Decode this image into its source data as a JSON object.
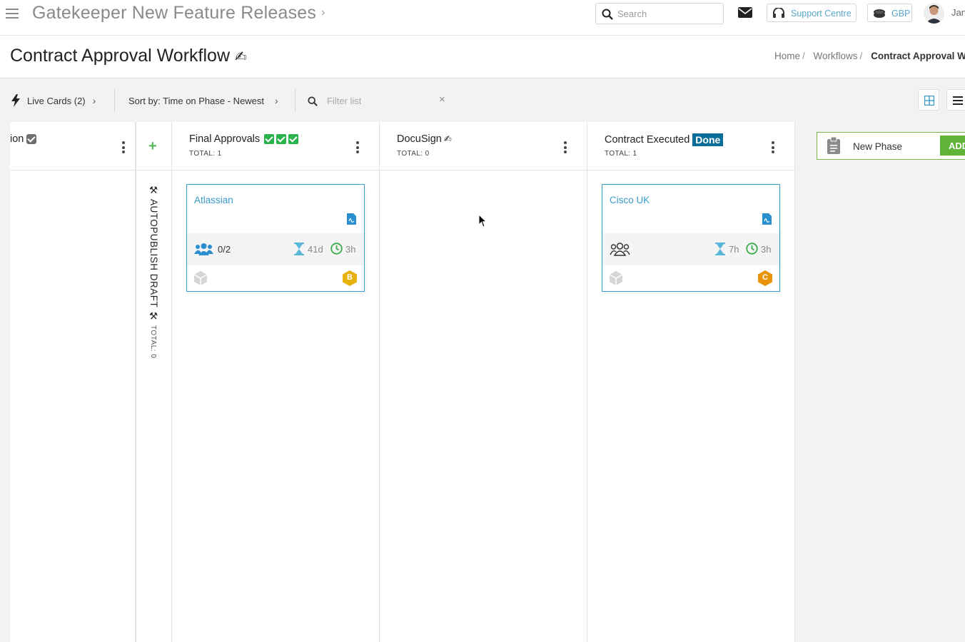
{
  "topbar": {
    "app_title": "Gatekeeper New Feature Releases",
    "title_chevron": "›",
    "search_placeholder": "Search",
    "support_label": "Support Centre",
    "currency_label": "GBP",
    "user_name": "Jan"
  },
  "page": {
    "title": "Contract Approval Workflow",
    "title_emoji": "✍",
    "breadcrumb": [
      "Home",
      "Workflows",
      "Contract Approval W"
    ],
    "breadcrumb_sep": "/"
  },
  "toolbar": {
    "live_cards": "Live Cards (2)",
    "sort_by": "Sort by: Time on Phase - Newest",
    "filter_placeholder": "Filter list",
    "clear": "×",
    "chevron": "›"
  },
  "columns": {
    "partial": {
      "title": "ion"
    },
    "collapsed": {
      "title": "⚒ AUTOPUBLISH DRAFT ⚒",
      "total": "TOTAL: 0",
      "add": "+"
    },
    "final_approvals": {
      "title": "Final Approvals",
      "total": "TOTAL: 1"
    },
    "docusign": {
      "title": "DocuSign",
      "emoji": "✍",
      "total": "TOTAL: 0"
    },
    "contract_executed": {
      "title": "Contract Executed",
      "badge": "Done",
      "total": "TOTAL: 1"
    }
  },
  "cards": [
    {
      "title": "Atlassian",
      "people_count": "0/2",
      "time_on_phase": "41d",
      "time_left": "3h",
      "grade": "B",
      "grade_color": "#e8b10c"
    },
    {
      "title": "Cisco UK",
      "people_count": "",
      "time_on_phase": "7h",
      "time_left": "3h",
      "grade": "C",
      "grade_color": "#e8950c"
    }
  ],
  "new_phase": {
    "placeholder": "New Phase",
    "add_label": "ADD"
  },
  "colors": {
    "accent_blue": "#3a9bc9",
    "done_badge": "#0b6e99",
    "green": "#5fb336"
  }
}
